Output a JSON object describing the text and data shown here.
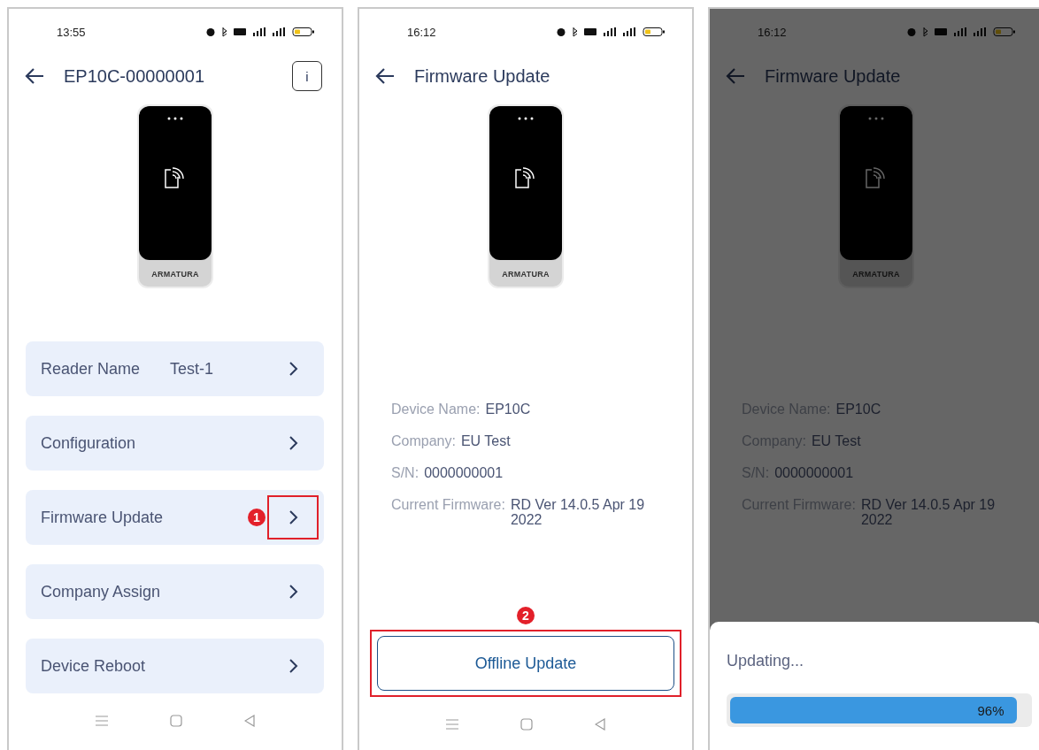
{
  "screens": [
    {
      "kind": "device",
      "dimmed": false,
      "nav_bar": true,
      "status_bar": {
        "time": "13:55"
      },
      "title": "EP10C-00000001",
      "info_button": "i",
      "device_brand": "ARMATURA",
      "menu": [
        {
          "label": "Reader Name",
          "value": "Test-1",
          "highlighted": false
        },
        {
          "label": "Configuration",
          "highlighted": false
        },
        {
          "label": "Firmware Update",
          "highlighted": true,
          "callout": "1"
        },
        {
          "label": "Company Assign",
          "highlighted": false
        },
        {
          "label": "Device Reboot",
          "highlighted": false
        }
      ]
    },
    {
      "kind": "firmware",
      "dimmed": false,
      "nav_bar": true,
      "status_bar": {
        "time": "16:12"
      },
      "title": "Firmware Update",
      "device_brand": "ARMATURA",
      "info": [
        {
          "label": "Device Name:",
          "value": "EP10C"
        },
        {
          "label": "Company:",
          "value": "EU Test"
        },
        {
          "label": "S/N:",
          "value": "0000000001"
        },
        {
          "label": "Current Firmware:",
          "value": "RD Ver 14.0.5 Apr 19 2022"
        }
      ],
      "action": {
        "label": "Offline Update",
        "highlighted": true,
        "callout": "2"
      }
    },
    {
      "kind": "firmware",
      "dimmed": true,
      "nav_bar": false,
      "status_bar": {
        "time": "16:12"
      },
      "title": "Firmware Update",
      "device_brand": "ARMATURA",
      "info": [
        {
          "label": "Device Name:",
          "value": "EP10C"
        },
        {
          "label": "Company:",
          "value": "EU Test"
        },
        {
          "label": "S/N:",
          "value": "0000000001"
        },
        {
          "label": "Current Firmware:",
          "value": "RD Ver 14.0.5 Apr 19 2022"
        }
      ],
      "dialog": {
        "title": "Updating...",
        "level": 0.96,
        "reading": "96%"
      }
    }
  ]
}
